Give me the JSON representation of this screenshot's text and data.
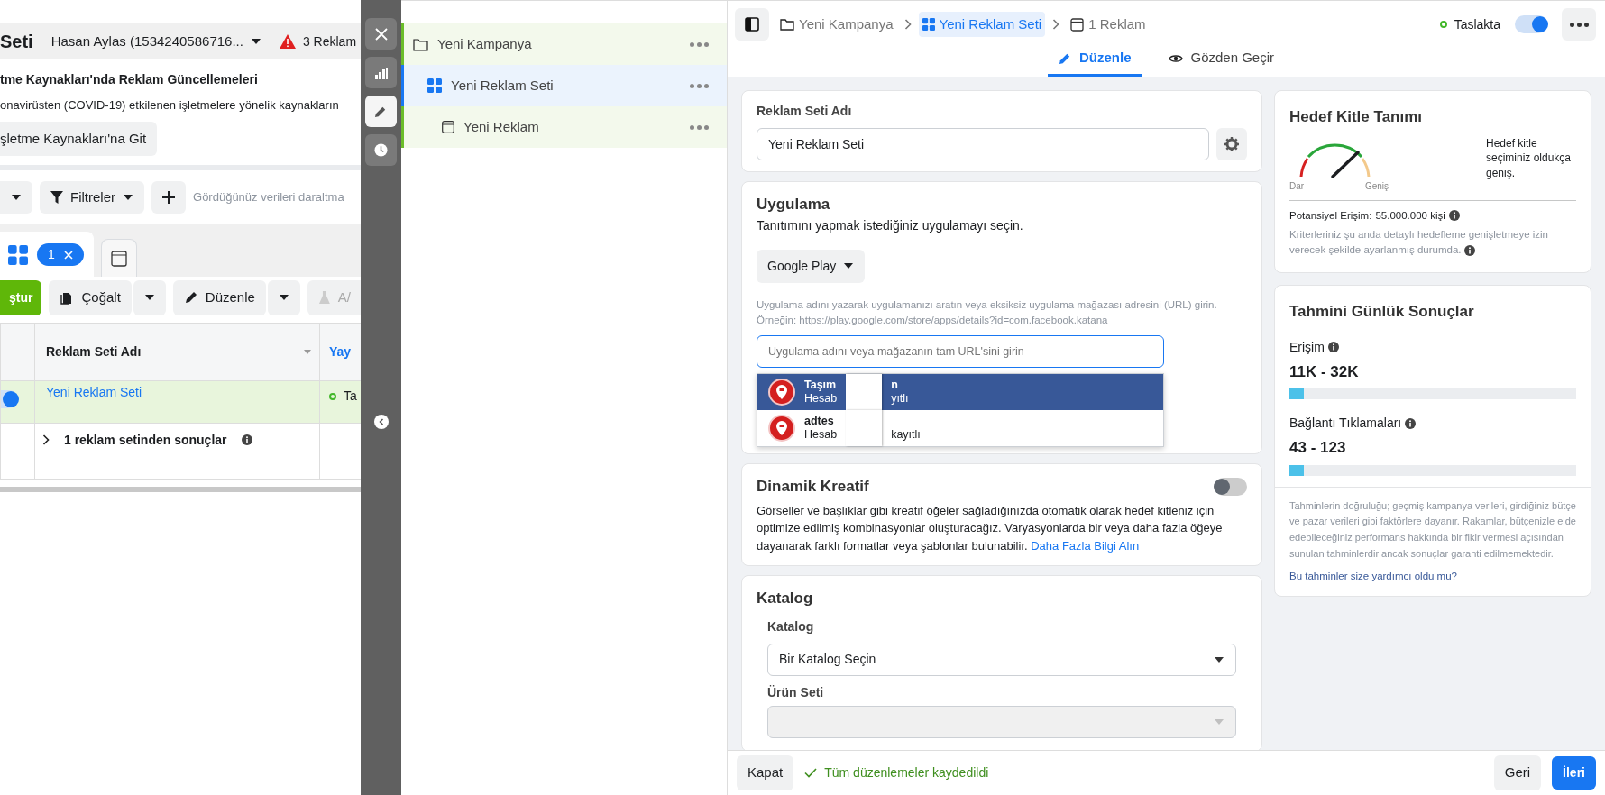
{
  "background_page": {
    "title": "Seti",
    "account": "Hasan Aylas (1534240586716...",
    "alert": "3 Reklam",
    "notice": {
      "title": "tme Kaynakları'nda Reklam Güncellemeleri",
      "text": "onavirüsten (COVID-19) etkilenen işletmelere yönelik kaynakların",
      "button": "şletme Kaynakları'na Git"
    },
    "filter_bar": {
      "filters": "Filtreler",
      "placeholder": "Gördüğünüz verileri daraltma"
    },
    "tabs": [
      {
        "kind": "adsets",
        "badge": "1",
        "selected": true
      },
      {
        "kind": "ads",
        "selected": false
      }
    ],
    "toolbar": {
      "create": "ştur",
      "duplicate": "Çoğalt",
      "edit": "Düzenle",
      "ab_test": "A/"
    },
    "table": {
      "columns": [
        "Reklam Seti Adı",
        "Yay"
      ],
      "rows": [
        {
          "on": true,
          "name": "Yeni Reklam Seti",
          "status": "Ta"
        }
      ],
      "summary": "1 reklam setinden sonuçlar"
    }
  },
  "side_toolbar": [
    {
      "kind": "close",
      "selected": false
    },
    {
      "kind": "chart",
      "selected": false
    },
    {
      "kind": "edit",
      "selected": true
    },
    {
      "kind": "history",
      "selected": false
    }
  ],
  "tree": [
    {
      "kind": "campaign",
      "label": "Yeni Kampanya",
      "selected": false,
      "children": [
        {
          "kind": "adset",
          "label": "Yeni Reklam Seti",
          "selected": true,
          "children": [
            {
              "kind": "ad",
              "label": "Yeni Reklam",
              "selected": false
            }
          ]
        }
      ]
    }
  ],
  "editor": {
    "breadcrumbs": [
      {
        "kind": "campaign",
        "label": "Yeni Kampanya",
        "selected": false
      },
      {
        "kind": "adset",
        "label": "Yeni Reklam Seti",
        "selected": true
      },
      {
        "kind": "ad",
        "label": "1 Reklam",
        "selected": false
      }
    ],
    "status": {
      "label": "Taslakta",
      "on": true
    },
    "tabs": [
      {
        "kind": "edit",
        "label": "Düzenle",
        "selected": true
      },
      {
        "kind": "review",
        "label": "Gözden Geçir",
        "selected": false
      }
    ],
    "ad_set_name": {
      "label": "Reklam Seti Adı",
      "value": "Yeni Reklam Seti"
    },
    "app": {
      "title": "Uygulama",
      "subtitle": "Tanıtımını yapmak istediğiniz uygulamayı seçin.",
      "store": "Google Play",
      "help": [
        "Uygulama adını yazarak uygulamanızı aratın veya eksiksiz uygulama mağazası adresini (URL) girin.",
        "Örneğin: https://play.google.com/store/apps/details?id=com.facebook.katana"
      ],
      "placeholder": "Uygulama adını veya mağazanın tam URL'sini girin",
      "suggestions": [
        {
          "name": "Taşım",
          "name_tail": "n",
          "subtitle": "Hesab",
          "subtitle_tail": "yıtlı",
          "selected": true
        },
        {
          "name": "adtes",
          "subtitle": "Hesab",
          "subtitle_tail": "kayıtlı",
          "selected": false
        }
      ]
    },
    "dynamic_creative": {
      "title": "Dinamik Kreatif",
      "on": false,
      "text": "Görseller ve başlıklar gibi kreatif öğeler sağladığınızda otomatik olarak hedef kitleniz için optimize edilmiş kombinasyonlar oluşturacağız. Varyasyonlarda bir veya daha fazla öğeye dayanarak farklı formatlar veya şablonlar bulunabilir.",
      "link": "Daha Fazla Bilgi Alın"
    },
    "catalog": {
      "title": "Katalog",
      "catalog_label": "Katalog",
      "catalog_value": "Bir Katalog Seçin",
      "product_set_label": "Ürün Seti",
      "product_set_disabled": true
    }
  },
  "audience": {
    "title": "Hedef Kitle Tanımı",
    "narrow": "Dar",
    "broad": "Geniş",
    "description": "Hedef kitle seçiminiz oldukça geniş.",
    "potential_label": "Potansiyel Erişim:",
    "potential_value": "55.000.000 kişi",
    "note": "Kriterleriniz şu anda detaylı hedefleme genişletmeye izin verecek şekilde ayarlanmış durumda."
  },
  "estimates": {
    "title": "Tahmini Günlük Sonuçlar",
    "metrics": [
      {
        "label": "Erişim",
        "value": "11K - 32K",
        "level": 0.05
      },
      {
        "label": "Bağlantı Tıklamaları",
        "value": "43 - 123",
        "level": 0.05
      }
    ],
    "disclaimer": "Tahminlerin doğruluğu; geçmiş kampanya verileri, girdiğiniz bütçe ve pazar verileri gibi faktörlere dayanır. Rakamlar, bütçenizle elde edebileceğiniz performans hakkında bir fikir vermesi açısından sunulan tahminlerdir ancak sonuçlar garanti edilmemektedir.",
    "link": "Bu tahminler size yardımcı oldu mu?"
  },
  "footer": {
    "close": "Kapat",
    "saved": "Tüm düzenlemeler kaydedildi",
    "back": "Geri",
    "next": "İleri"
  }
}
